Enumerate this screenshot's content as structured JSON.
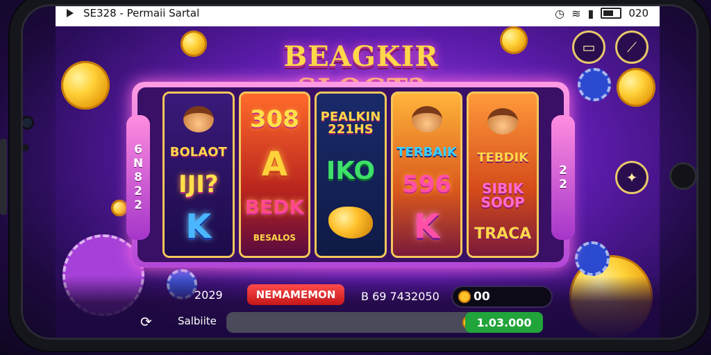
{
  "statusbar": {
    "left_text": "SE328 - Permaii Sartal",
    "time": "020"
  },
  "game": {
    "title": "BEAGKIR SLOGT?",
    "side_left": [
      "6",
      "N",
      "8",
      "2",
      "2"
    ],
    "side_right": [
      "2",
      "2"
    ],
    "reels": [
      {
        "top": "BOLAOT",
        "mid": "IJI?",
        "bottom": "K"
      },
      {
        "top": "308",
        "mid": "A",
        "bottom": "BEDK",
        "bottom_sub": "BESALOS"
      },
      {
        "top": "PEALKIN 221HS",
        "mid": "IKO",
        "bottom": ""
      },
      {
        "top": "TERBAIK",
        "mid": "596",
        "bottom": "K"
      },
      {
        "top": "TEBDIK",
        "mid": "SIBIK SOOP",
        "bottom": "TRACA"
      }
    ]
  },
  "bottom": {
    "left_value": "2029",
    "button_label": "NEMAMEMON",
    "bet_value": "B 69 7432050",
    "coin_value": "00",
    "balance_label": "Salbiite",
    "balance_value": "1.03.000"
  },
  "icons": {
    "chat": "chat-icon",
    "feather": "feather-icon",
    "settings": "settings-icon",
    "refresh": "refresh-icon"
  },
  "colors": {
    "accent": "#ffd84a",
    "danger": "#c41818",
    "balance": "#21a43a"
  }
}
